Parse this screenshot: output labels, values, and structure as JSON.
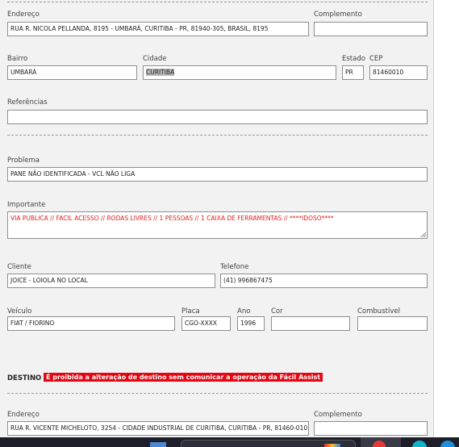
{
  "address": {
    "endereco_label": "Endereço",
    "endereco_value": "RUA R. NICOLA PELLANDA, 8195 - UMBARÁ, CURITIBA - PR, 81940-305, BRASIL, 8195",
    "complemento_label": "Complemento",
    "complemento_value": "",
    "bairro_label": "Bairro",
    "bairro_value": "UMBARÁ",
    "cidade_label": "Cidade",
    "cidade_value": "CURITIBA",
    "estado_label": "Estado",
    "estado_value": "PR",
    "cep_label": "CEP",
    "cep_value": "81460010",
    "referencias_label": "Referências",
    "referencias_value": ""
  },
  "problem": {
    "problema_label": "Problema",
    "problema_value": "PANE NÃO IDENTIFICADA - VCL NÃO LIGA",
    "importante_label": "Importante",
    "importante_value": "VIA PUBLICA // FACIL ACESSO // RODAS LIVRES // 1 PESSOAS // 1 CAIXA DE FERRAMENTAS // ****IDOSO****"
  },
  "client": {
    "cliente_label": "Cliente",
    "cliente_value": "JOICE - LOIOLA NO LOCAL",
    "telefone_label": "Telefone",
    "telefone_value": "(41) 996867475"
  },
  "vehicle": {
    "veiculo_label": "Veículo",
    "veiculo_value": "FIAT / FIORINO",
    "placa_label": "Placa",
    "placa_value": "CGO-XXXX",
    "ano_label": "Ano",
    "ano_value": "1996",
    "cor_label": "Cor",
    "cor_value": "",
    "combustivel_label": "Combustível",
    "combustivel_value": ""
  },
  "destination": {
    "title": "DESTINO",
    "warning": "É proibida a alteração de destino sem comunicar a operação da Fácil Assist",
    "endereco_label": "Endereço",
    "endereco_value": "RUA R. VICENTE MICHELOTO, 3254 - CIDADE INDUSTRIAL DE CURITIBA, CURITIBA - PR, 81460-010,",
    "complemento_label": "Complemento",
    "complemento_value": ""
  },
  "colors": {
    "warning_bg": "#e30613",
    "important_text": "#e02020"
  }
}
